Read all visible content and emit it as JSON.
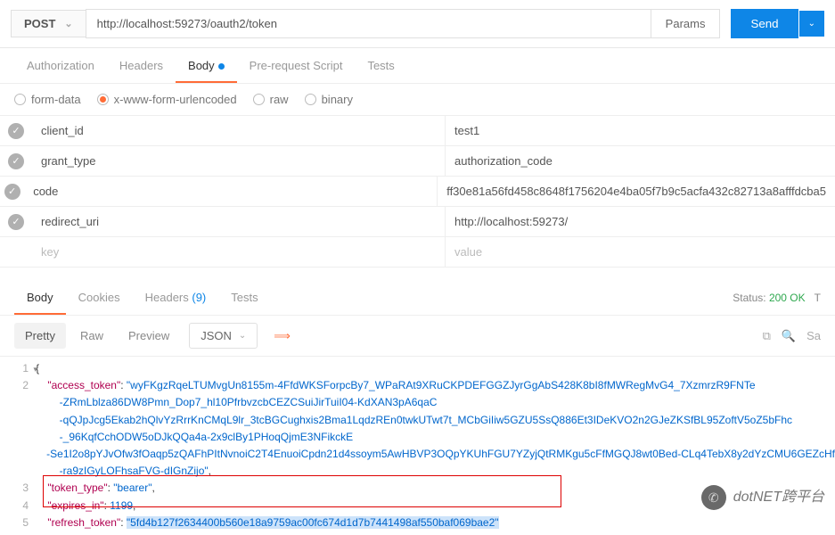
{
  "request": {
    "method": "POST",
    "url": "http://localhost:59273/oauth2/token",
    "params_btn": "Params",
    "send_btn": "Send"
  },
  "req_tabs": {
    "auth": "Authorization",
    "headers": "Headers",
    "body": "Body",
    "prereq": "Pre-request Script",
    "tests": "Tests"
  },
  "body_types": {
    "form": "form-data",
    "xwww": "x-www-form-urlencoded",
    "raw": "raw",
    "binary": "binary"
  },
  "params": [
    {
      "key": "client_id",
      "value": "test1"
    },
    {
      "key": "grant_type",
      "value": "authorization_code"
    },
    {
      "key": "code",
      "value": "ff30e81a56fd458c8648f1756204e4ba05f7b9c5acfa432c82713a8afffdcba5"
    },
    {
      "key": "redirect_uri",
      "value": "http://localhost:59273/"
    }
  ],
  "param_placeholder": {
    "key": "key",
    "value": "value"
  },
  "resp_tabs": {
    "body": "Body",
    "cookies": "Cookies",
    "headers": "Headers",
    "headers_n": "(9)",
    "tests": "Tests"
  },
  "status": {
    "label": "Status:",
    "code": "200 OK",
    "extra": "T"
  },
  "view": {
    "pretty": "Pretty",
    "raw": "Raw",
    "preview": "Preview",
    "json": "JSON",
    "save": "Sa"
  },
  "response": {
    "access_token_key": "\"access_token\"",
    "access_token_l1": "\"wyFKgzRqeLTUMvgUn8155m-4FfdWKSForpcBy7_WPaRAt9XRuCKPDEFGGZJyrGgAbS428K8bI8fMWRegMvG4_7XzmrzR9FNTe",
    "access_token_l2": "-ZRmLblza86DW8Pmn_Dop7_hl10PfrbvzcbCEZCSuiJirTuiI04-KdXAN3pA6qaC",
    "access_token_l3": "-qQJpJcg5Ekab2hQlvYzRrrKnCMqL9lr_3tcBGCughxis2Bma1LqdzREn0twkUTwt7t_MCbGiIiw5GZU5SsQ886Et3IDeKVO2n2GJeZKSfBL95ZoftV5oZ5bFhc",
    "access_token_l4": "-_96KqfCchODW5oDJkQQa4a-2x9clBy1PHoqQjmE3NFikckE",
    "access_token_l5": "-Se1I2o8pYJvOfw3fOaqp5zQAFhPItNvnoiC2T4EnuoiCpdn21d4ssoym5AwHBVP3OQpYKUhFGU7YZyjQtRMKgu5cFfMGQJ8wt0Bed-CLq4TebX8y2dYzCMU6GEZcHf",
    "access_token_l6": "-ra9zIGyLOFhsaFVG-dIGnZijo\"",
    "token_type_key": "\"token_type\"",
    "token_type_val": "\"bearer\"",
    "expires_key": "\"expires_in\"",
    "expires_val": "1199",
    "refresh_key": "\"refresh_token\"",
    "refresh_val": "\"5fd4b127f2634400b560e18a9759ac00fc674d1d7b7441498af550baf069bae2\""
  },
  "watermark": "dotNET跨平台"
}
